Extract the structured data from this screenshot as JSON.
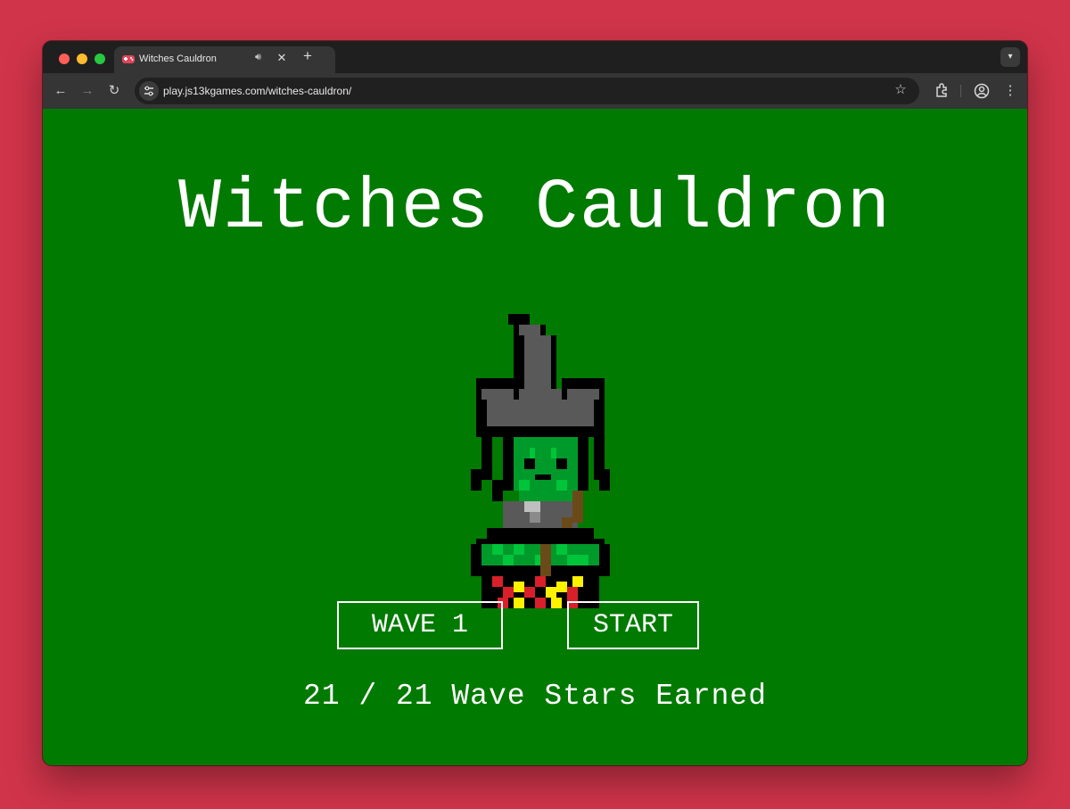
{
  "browser": {
    "tab_title": "Witches Cauldron",
    "url": "play.js13kgames.com/witches-cauldron/",
    "icons": [
      "gamepad-icon",
      "speaker-icon",
      "close-icon",
      "plus-icon",
      "chevron-down-icon",
      "back-icon",
      "forward-icon",
      "reload-icon",
      "site-settings-icon",
      "star-icon",
      "extensions-icon",
      "profile-icon",
      "more-icon"
    ]
  },
  "game": {
    "title": "Witches Cauldron",
    "wave_label": "WAVE 1",
    "start_label": "START",
    "stars_text": "21 / 21 Wave Stars Earned",
    "background": "#007a00"
  },
  "colors": {
    "accent": "#d0344a",
    "hat": "#595959",
    "skin": "#009a2a",
    "potion": "#00c43a",
    "fire_red": "#d9202a",
    "fire_yellow": "#fff200",
    "broom": "#6b4a1a"
  }
}
